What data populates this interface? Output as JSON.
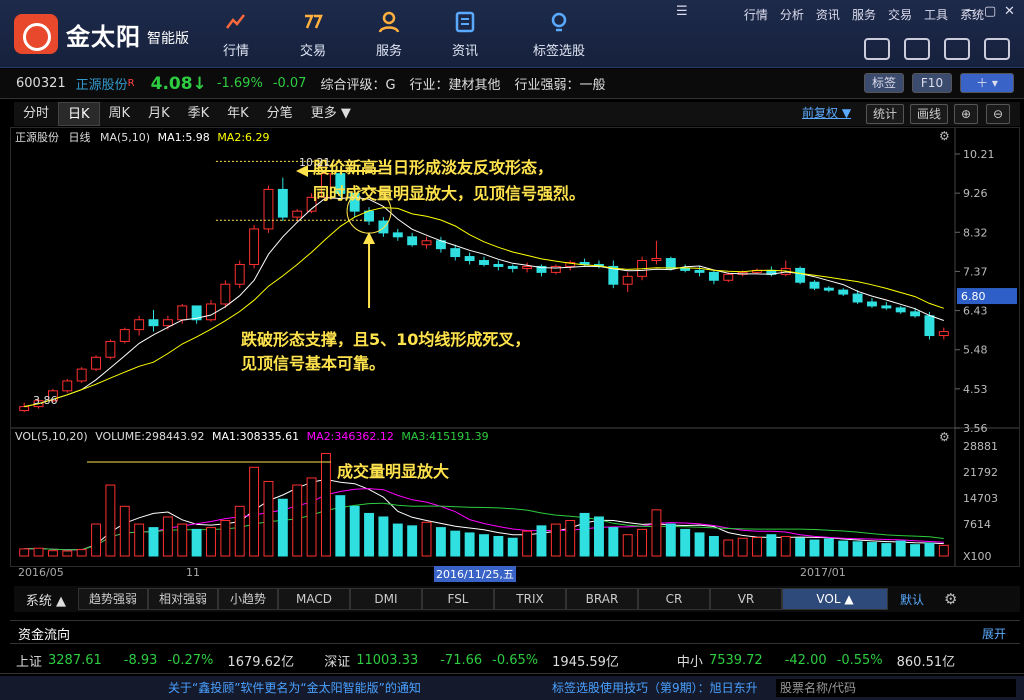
{
  "app": {
    "brand": "金太阳",
    "edition": "智能版"
  },
  "nav": [
    {
      "label": "行情",
      "icon": "trend-icon"
    },
    {
      "label": "交易",
      "icon": "trade-icon"
    },
    {
      "label": "服务",
      "icon": "user-icon"
    },
    {
      "label": "资讯",
      "icon": "news-icon"
    },
    {
      "label": "标签选股",
      "icon": "bulb-icon"
    }
  ],
  "menu": [
    "行情",
    "分析",
    "资讯",
    "服务",
    "交易",
    "工具",
    "系统"
  ],
  "quote": {
    "code": "600321",
    "name": "正源股份",
    "flag": "R",
    "price": "4.08↓",
    "pct": "-1.69%",
    "chg": "-0.07",
    "rating": "综合评级：G",
    "industry": "行业：建材其他",
    "strength": "行业强弱：一般",
    "btn_tag": "标签",
    "btn_f10": "F10"
  },
  "tabs": [
    "分时",
    "日K",
    "周K",
    "月K",
    "季K",
    "年K",
    "分笔",
    "更多 ▼"
  ],
  "tabs_right": {
    "adjust": "前复权 ▼",
    "stat": "统计",
    "draw": "画线"
  },
  "price_legend": {
    "name": "正源股份",
    "period": "日线",
    "ma": "MA(5,10)",
    "ma1": "MA1:5.98",
    "ma2": "MA2:6.29"
  },
  "vol_legend": {
    "vol": "VOL(5,10,20)",
    "volume": "VOLUME:298443.92",
    "ma1": "MA1:308335.61",
    "ma2": "MA2:346362.12",
    "ma3": "MA3:415191.39"
  },
  "annotations": {
    "a1_l1": "股价新高当日形成淡友反攻形态，",
    "a1_l2": "同时成交量明显放大，见顶信号强烈。",
    "a2_l1": "跌破形态支撑，且5、10均线形成死叉，",
    "a2_l2": "见顶信号基本可靠。",
    "a3": "成交量明显放大",
    "high_label": "10.21",
    "low_label": "3.86"
  },
  "chart_data": {
    "type": "candlestick",
    "price_axis": {
      "ticks": [
        "10.21",
        "9.26",
        "8.32",
        "7.37",
        "6.43",
        "5.48",
        "4.53",
        "3.56"
      ],
      "current": "6.80"
    },
    "volume_axis": {
      "ticks": [
        "28881",
        "21792",
        "14703",
        "7614"
      ],
      "unit": "X100"
    },
    "x_ticks": [
      "2016/05",
      "11",
      "2016/11/25,五",
      "2017/01"
    ],
    "ohlc": [
      [
        3.9,
        4.1,
        3.86,
        4.0
      ],
      [
        4.0,
        4.2,
        3.95,
        4.15
      ],
      [
        4.15,
        4.45,
        4.1,
        4.4
      ],
      [
        4.4,
        4.7,
        4.35,
        4.65
      ],
      [
        4.65,
        5.0,
        4.6,
        4.95
      ],
      [
        4.95,
        5.3,
        4.9,
        5.25
      ],
      [
        5.25,
        5.7,
        5.2,
        5.65
      ],
      [
        5.65,
        6.0,
        5.6,
        5.95
      ],
      [
        5.95,
        6.3,
        5.8,
        6.2
      ],
      [
        6.2,
        6.45,
        5.9,
        6.05
      ],
      [
        6.05,
        6.3,
        5.95,
        6.2
      ],
      [
        6.2,
        6.6,
        6.1,
        6.55
      ],
      [
        6.55,
        6.4,
        6.1,
        6.2
      ],
      [
        6.2,
        6.7,
        6.15,
        6.6
      ],
      [
        6.6,
        7.2,
        6.5,
        7.1
      ],
      [
        7.1,
        7.7,
        7.0,
        7.6
      ],
      [
        7.6,
        8.6,
        7.5,
        8.5
      ],
      [
        8.5,
        9.6,
        8.4,
        9.5
      ],
      [
        9.5,
        9.8,
        8.7,
        8.8
      ],
      [
        8.8,
        9.0,
        8.7,
        8.95
      ],
      [
        8.95,
        9.4,
        8.9,
        9.3
      ],
      [
        9.3,
        10.21,
        9.2,
        9.9
      ],
      [
        9.9,
        10.0,
        9.3,
        9.4
      ],
      [
        9.4,
        9.5,
        8.8,
        8.95
      ],
      [
        8.95,
        9.05,
        8.6,
        8.7
      ],
      [
        8.7,
        8.8,
        8.3,
        8.4
      ],
      [
        8.4,
        8.5,
        8.2,
        8.3
      ],
      [
        8.3,
        8.4,
        8.05,
        8.1
      ],
      [
        8.1,
        8.3,
        8.0,
        8.2
      ],
      [
        8.2,
        8.3,
        7.9,
        8.0
      ],
      [
        8.0,
        8.1,
        7.7,
        7.8
      ],
      [
        7.8,
        7.9,
        7.6,
        7.7
      ],
      [
        7.7,
        7.8,
        7.55,
        7.6
      ],
      [
        7.6,
        7.7,
        7.45,
        7.55
      ],
      [
        7.55,
        7.6,
        7.4,
        7.5
      ],
      [
        7.5,
        7.65,
        7.4,
        7.55
      ],
      [
        7.55,
        7.6,
        7.3,
        7.4
      ],
      [
        7.4,
        7.6,
        7.35,
        7.55
      ],
      [
        7.55,
        7.7,
        7.45,
        7.65
      ],
      [
        7.65,
        7.75,
        7.55,
        7.6
      ],
      [
        7.6,
        7.7,
        7.5,
        7.55
      ],
      [
        7.55,
        7.7,
        7.0,
        7.1
      ],
      [
        7.1,
        7.4,
        6.9,
        7.3
      ],
      [
        7.3,
        7.8,
        7.2,
        7.7
      ],
      [
        7.7,
        8.2,
        7.6,
        7.75
      ],
      [
        7.75,
        7.8,
        7.45,
        7.5
      ],
      [
        7.5,
        7.6,
        7.4,
        7.45
      ],
      [
        7.45,
        7.55,
        7.3,
        7.4
      ],
      [
        7.4,
        7.45,
        7.1,
        7.2
      ],
      [
        7.2,
        7.4,
        7.15,
        7.35
      ],
      [
        7.35,
        7.45,
        7.3,
        7.4
      ],
      [
        7.4,
        7.5,
        7.35,
        7.45
      ],
      [
        7.45,
        7.55,
        7.3,
        7.35
      ],
      [
        7.35,
        7.7,
        7.3,
        7.5
      ],
      [
        7.5,
        7.55,
        7.1,
        7.15
      ],
      [
        7.15,
        7.2,
        6.95,
        7.0
      ],
      [
        7.0,
        7.05,
        6.9,
        6.95
      ],
      [
        6.95,
        7.0,
        6.8,
        6.85
      ],
      [
        6.85,
        6.95,
        6.6,
        6.65
      ],
      [
        6.65,
        6.75,
        6.5,
        6.55
      ],
      [
        6.55,
        6.65,
        6.45,
        6.5
      ],
      [
        6.5,
        6.55,
        6.35,
        6.4
      ],
      [
        6.4,
        6.5,
        6.25,
        6.3
      ],
      [
        6.3,
        6.4,
        5.7,
        5.8
      ],
      [
        5.8,
        6.0,
        5.7,
        5.9
      ]
    ],
    "volume": [
      2000,
      2200,
      1500,
      1400,
      1800,
      9000,
      20000,
      14000,
      9000,
      8000,
      11000,
      9000,
      7500,
      8000,
      10000,
      14000,
      25000,
      21000,
      16000,
      20000,
      22000,
      28881,
      17000,
      14000,
      12000,
      11000,
      9000,
      8500,
      9500,
      8000,
      7000,
      6500,
      6000,
      5500,
      5000,
      7000,
      8500,
      9000,
      10000,
      12000,
      11000,
      8000,
      6000,
      7500,
      13000,
      9000,
      7500,
      6500,
      5500,
      4500,
      5000,
      5200,
      6000,
      5500,
      5000,
      4500,
      4800,
      4200,
      4000,
      3800,
      3500,
      4200,
      3200,
      3600,
      3000
    ],
    "price_range": [
      3.56,
      10.6
    ],
    "volume_range": [
      0,
      31000
    ]
  },
  "ind_tabs": [
    "系统 ▲",
    "趋势强弱",
    "相对强弱",
    "小趋势",
    "MACD",
    "DMI",
    "FSL",
    "TRIX",
    "BRAR",
    "CR",
    "VR",
    "VOL ▲"
  ],
  "ind_right": "默认",
  "fund": {
    "label": "资金流向",
    "expand": "展开"
  },
  "indices": [
    {
      "name": "上证",
      "val": "3287.61",
      "chg": "-8.93",
      "pct": "-0.27%",
      "amt": "1679.62亿"
    },
    {
      "name": "深证",
      "val": "11003.33",
      "chg": "-71.66",
      "pct": "-0.65%",
      "amt": "1945.59亿"
    },
    {
      "name": "中小",
      "val": "7539.72",
      "chg": "-42.00",
      "pct": "-0.55%",
      "amt": "860.51亿"
    }
  ],
  "status": {
    "news": "关于“鑫投顾”软件更名为“金太阳智能版”的通知",
    "tip": "标签选股使用技巧（第9期）：旭日东升",
    "search": "股票名称/代码"
  },
  "colors": {
    "up": "#ff3030",
    "down": "#30e0e0",
    "ma1": "#ffffff",
    "ma2": "#ffff00",
    "annot": "#ffe34d",
    "green": "#2ecc40"
  }
}
